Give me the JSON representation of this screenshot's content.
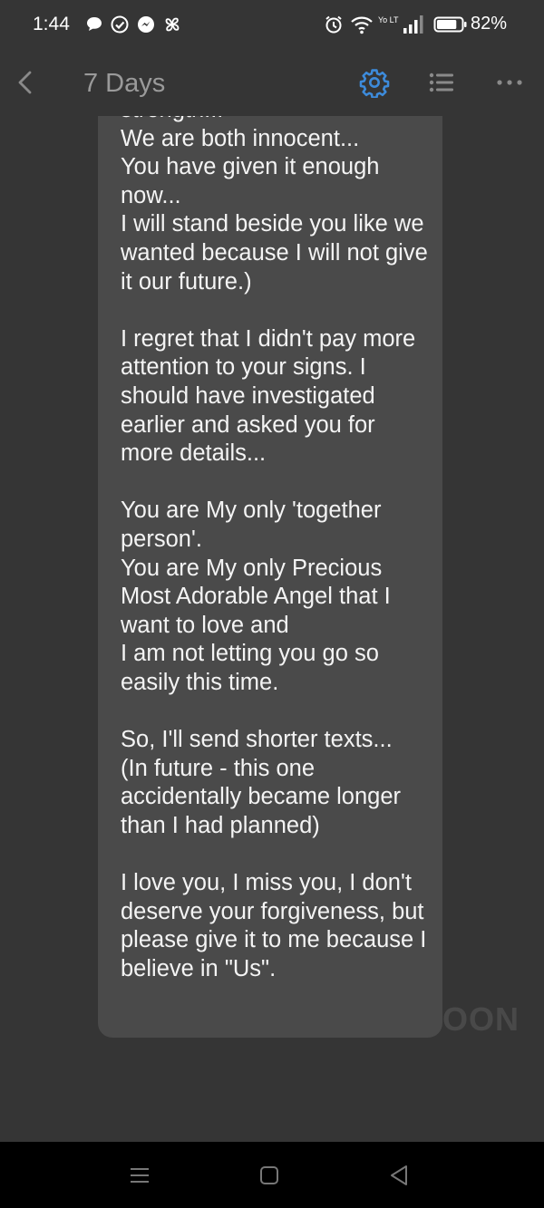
{
  "status_bar": {
    "time": "1:44",
    "network_label": "Yo LTE",
    "battery_percent": "82%",
    "battery_level": 0.82,
    "notification_icons": [
      "chat-bubble-icon",
      "check-circle-icon",
      "messenger-icon",
      "pinwheel-icon"
    ]
  },
  "header": {
    "title": "7 Days",
    "accent_color": "#3d8bdb"
  },
  "message": {
    "text": "strength...\nWe are both innocent...\nYou have given it enough now...\nI will stand beside you like we wanted because I will not give it our future.)\n\nI regret that I didn't pay more attention to your signs. I should have investigated earlier and asked you for more details...\n\nYou are My only 'together person'.\nYou are My only Precious Most Adorable Angel that I want to love and\nI am not letting you go so easily this time.\n\nSo, I'll send shorter texts...\n(In future - this one accidentally became longer than I had planned)\n\nI love you, I miss you, I don't deserve your forgiveness, but please give it to me because I believe in \"Us\"."
  },
  "watermark": "OON"
}
